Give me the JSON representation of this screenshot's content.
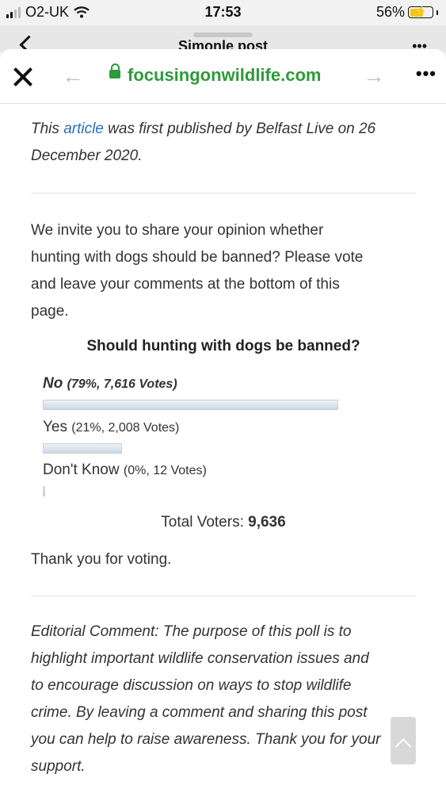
{
  "status_bar": {
    "carrier": "O2-UK",
    "time": "17:53",
    "battery": "56%"
  },
  "behind_sheet": {
    "title": "Simonle post"
  },
  "browser": {
    "domain": "focusingonwildlife.com"
  },
  "article": {
    "intro_prefix": "This ",
    "intro_link": "article",
    "intro_rest_line1": " was first published by Belfast Live on 26",
    "intro_line2": "December 2020.",
    "invite_lines": [
      "We invite you to share your opinion whether",
      "hunting with dogs should be banned? Please vote",
      "and leave your comments at the bottom of this",
      "page."
    ],
    "thanks": "Thank you for voting.",
    "editorial_lines": [
      "Editorial Comment: The purpose of this poll is to",
      "highlight important wildlife conservation issues and",
      "to encourage discussion on ways to stop wildlife",
      "crime. By leaving a comment and sharing this post",
      "you can help to raise awareness. Thank you for your",
      "support."
    ]
  },
  "poll": {
    "question": "Should hunting with dogs be banned?",
    "options": [
      {
        "label": "No",
        "detail": "(79%, 7,616 Votes)",
        "percent": 79
      },
      {
        "label": "Yes",
        "detail": "(21%, 2,008 Votes)",
        "percent": 21
      },
      {
        "label": "Don't Know",
        "detail": "(0%, 12 Votes)",
        "percent": 0
      }
    ],
    "total_label": "Total Voters:",
    "total_value": "9,636"
  },
  "colors": {
    "link": "#2c6fb7",
    "secure": "#2e9a3a"
  }
}
